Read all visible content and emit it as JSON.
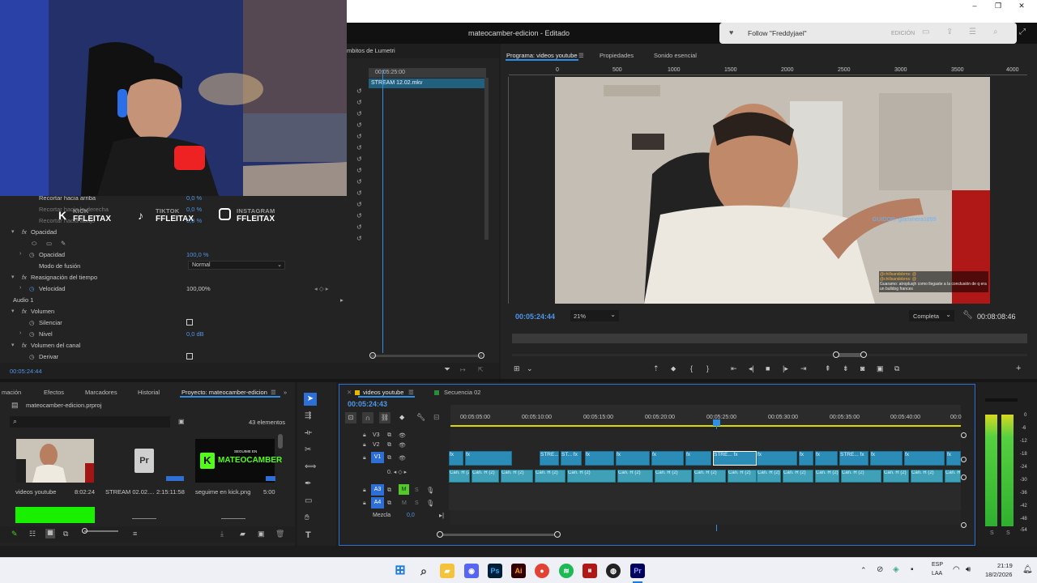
{
  "window": {
    "title": "mateocamber-edicion - Editado",
    "minimize": "–",
    "maximize": "❐",
    "close": "✕"
  },
  "toast": {
    "text": "Follow \"Freddyjael\"",
    "mode": "EDICIÓN"
  },
  "source_panel": {
    "tab": "mbitos de Lumetri",
    "timecode": "00:05:25:00",
    "clip": "STREAM 12.02.mkv"
  },
  "social": [
    {
      "network": "KICK",
      "handle": "FFLEITAX"
    },
    {
      "network": "TIKTOK",
      "handle": "FFLEITAX"
    },
    {
      "network": "INSTAGRAM",
      "handle": "FFLEITAX"
    }
  ],
  "effects": {
    "rows": [
      {
        "label": "Recortar hacia arriba",
        "value": "0,0 %"
      },
      {
        "label": "Recortar hacia la derecha",
        "value": "0,0 %"
      },
      {
        "label": "Recortar hacia abajo",
        "value": "0,0 %"
      }
    ],
    "opacity_section": "Opacidad",
    "opacity_label": "Opacidad",
    "opacity_value": "100,0 %",
    "blend_label": "Modo de fusión",
    "blend_value": "Normal",
    "remap_section": "Reasignación del tiempo",
    "speed_label": "Velocidad",
    "speed_value": "100,00%",
    "audio_label": "Audio 1",
    "volume_section": "Volumen",
    "mute_label": "Silenciar",
    "level_label": "Nivel",
    "level_value": "0,0 dB",
    "channel_section": "Volumen del canal",
    "bypass_label": "Derivar",
    "timecode": "00:05:24:44"
  },
  "program": {
    "tabs": [
      "Programa: videos youtube",
      "Propiedades",
      "Sonido esencial"
    ],
    "ruler": [
      "0",
      "500",
      "1000",
      "1500",
      "2000",
      "2500",
      "3000",
      "3500",
      "4000"
    ],
    "timecode": "00:05:24:44",
    "zoom": "21%",
    "quality": "Completa",
    "duration": "00:08:08:46",
    "chat_name": "GUIDOR: giammera1899",
    "chat_lines": [
      "@chillsandobrns: @",
      "@chillsandobrns: @",
      "Guaramo: atroplusjh como llegaste a la conclusión de q era un bulldog frances"
    ]
  },
  "project": {
    "tabs": [
      "mación",
      "Efectos",
      "Marcadores",
      "Historial",
      "Proyecto: mateocamber-edicion"
    ],
    "file": "mateocamber-edicion.prproj",
    "count": "43 elementos",
    "items": [
      {
        "name": "videos youtube",
        "duration": "8:02:24"
      },
      {
        "name": "STREAM 02.02....",
        "duration": "2:15:11:58"
      },
      {
        "name": "seguime en kick.png",
        "duration": "5:00"
      }
    ],
    "kick_sub": "SEGUIME EN",
    "kick_name": "MATEOCAMBER"
  },
  "timeline": {
    "tabs": [
      "videos youtube",
      "Secuencia 02"
    ],
    "timecode": "00:05:24:43",
    "ruler": [
      "00:05:05:00",
      "00:05:10:00",
      "00:05:15:00",
      "00:05:20:00",
      "00:05:25:00",
      "00:05:30:00",
      "00:05:35:00",
      "00:05:40:00",
      "00:0"
    ],
    "tracks": [
      "V3",
      "V2",
      "V1",
      "A3",
      "A4"
    ],
    "mix_label": "Mezcla",
    "mix_value": "0,0",
    "clip_labels": [
      "fx",
      "STRE...",
      "ST..."
    ],
    "audio_label": "Can. R (2)"
  },
  "meter": {
    "labels": [
      "0",
      "-6",
      "-12",
      "-18",
      "-24",
      "-30",
      "-36",
      "-42",
      "-48",
      "-54"
    ],
    "solo": [
      "S",
      "S"
    ]
  },
  "taskbar": {
    "lang": "ESP",
    "lang2": "LAA",
    "time": "21:19",
    "date": "18/2/2026"
  }
}
